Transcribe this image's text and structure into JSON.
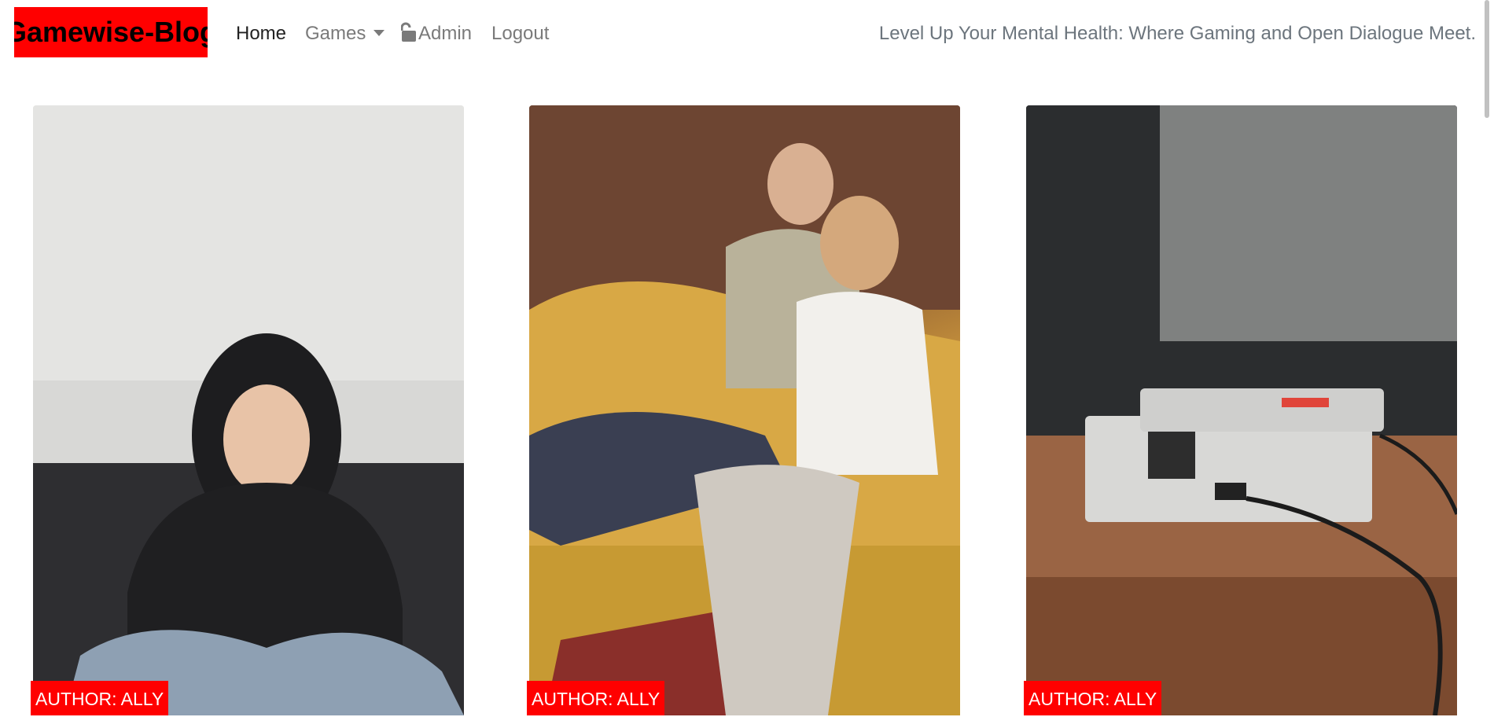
{
  "navbar": {
    "brand": "Gamewise-Blog",
    "links": {
      "home": "Home",
      "games": "Games",
      "admin": "Admin",
      "logout": "Logout"
    },
    "tagline": "Level Up Your Mental Health: Where Gaming and Open Dialogue Meet."
  },
  "posts": [
    {
      "author": "AUTHOR: ALLY"
    },
    {
      "author": "AUTHOR: ALLY"
    },
    {
      "author": "AUTHOR: ALLY"
    }
  ],
  "colors": {
    "brand_bg": "#ff0000",
    "author_badge_bg": "#ff0000",
    "nav_active": "#222222",
    "nav_muted": "#7a7a7a"
  },
  "icons": {
    "admin": "unlock-icon",
    "games_dropdown": "caret-down-icon"
  }
}
